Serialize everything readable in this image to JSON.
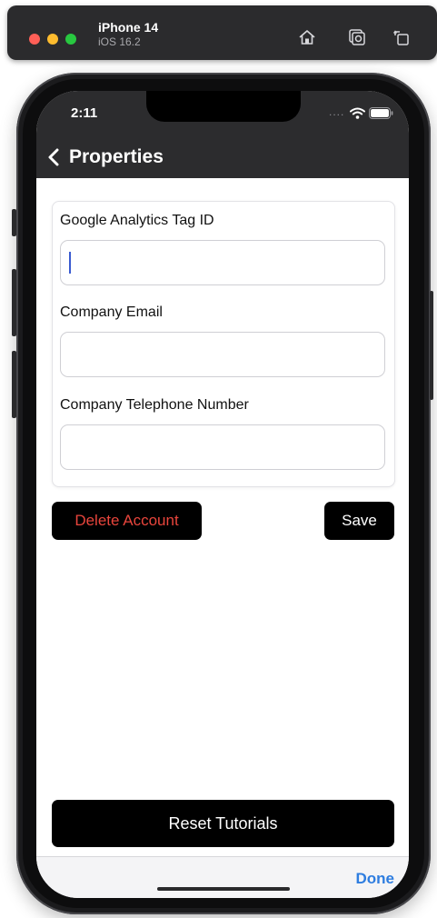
{
  "simulator": {
    "device_name": "iPhone 14",
    "os_version": "iOS 16.2",
    "icons": [
      "home-icon",
      "screenshot-icon",
      "rotate-icon"
    ]
  },
  "status_bar": {
    "time": "2:11",
    "dots": "....",
    "icons": [
      "wifi-icon",
      "battery-icon"
    ]
  },
  "nav": {
    "title": "Properties",
    "back_icon": "chevron-left-icon"
  },
  "form": {
    "fields": [
      {
        "label": "Google Analytics Tag ID",
        "value": "",
        "placeholder": "",
        "focused": true
      },
      {
        "label": "Company Email",
        "value": "",
        "placeholder": ""
      },
      {
        "label": "Company Telephone Number",
        "value": "",
        "placeholder": ""
      }
    ]
  },
  "actions": {
    "delete_label": "Delete Account",
    "save_label": "Save",
    "reset_label": "Reset Tutorials"
  },
  "accessory": {
    "done_label": "Done"
  },
  "colors": {
    "nav_background": "#2c2c2e",
    "delete_text": "#e8453c",
    "done_text": "#2e7de0",
    "caret": "#3a5bd0"
  }
}
